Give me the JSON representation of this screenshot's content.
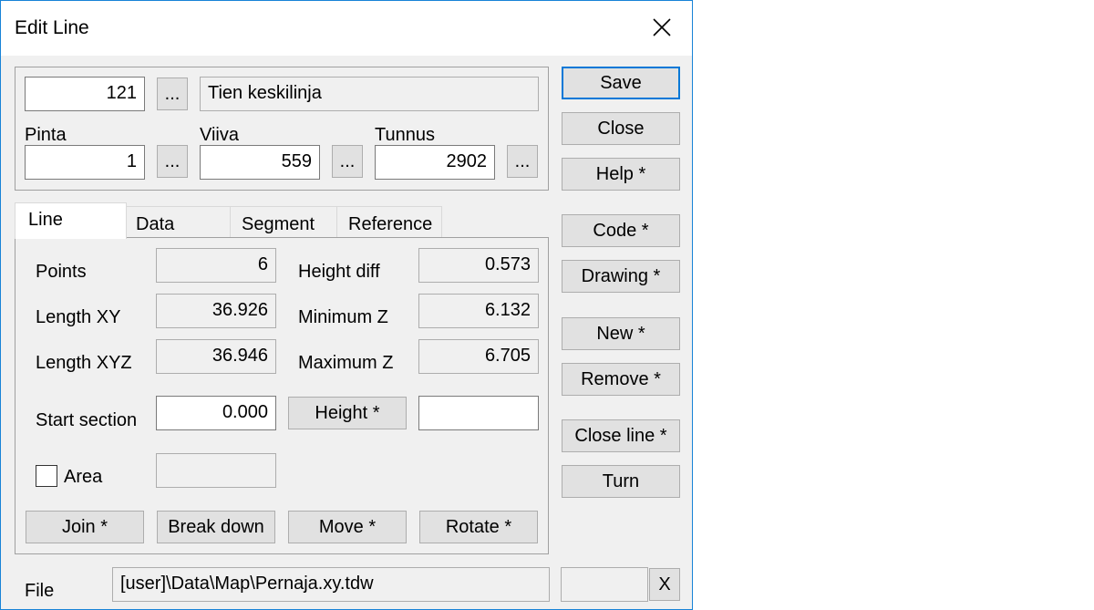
{
  "window": {
    "title": "Edit Line"
  },
  "header": {
    "code_value": "121",
    "code_name": "Tien keskilinja",
    "browse_label": "...",
    "pinta_label": "Pinta",
    "pinta_value": "1",
    "viiva_label": "Viiva",
    "viiva_value": "559",
    "tunnus_label": "Tunnus",
    "tunnus_value": "2902"
  },
  "tabs": [
    "Line",
    "Data",
    "Segment",
    "Reference"
  ],
  "line_tab": {
    "points_label": "Points",
    "points_value": "6",
    "length_xy_label": "Length XY",
    "length_xy_value": "36.926",
    "length_xyz_label": "Length XYZ",
    "length_xyz_value": "36.946",
    "height_diff_label": "Height diff",
    "height_diff_value": "0.573",
    "min_z_label": "Minimum Z",
    "min_z_value": "6.132",
    "max_z_label": "Maximum Z",
    "max_z_value": "6.705",
    "start_section_label": "Start section",
    "start_section_value": "0.000",
    "height_button": "Height *",
    "height_value": "",
    "area_label": "Area",
    "area_checked": false,
    "area_value": "",
    "join_button": "Join *",
    "break_down_button": "Break down",
    "move_button": "Move *",
    "rotate_button": "Rotate *"
  },
  "side_buttons": {
    "save": "Save",
    "close": "Close",
    "help": "Help *",
    "code": "Code *",
    "drawing": "Drawing *",
    "new": "New *",
    "remove": "Remove *",
    "close_line": "Close line *",
    "turn": "Turn"
  },
  "footer": {
    "file_label": "File",
    "file_path": "[user]\\Data\\Map\\Pernaja.xy.tdw",
    "extra_value": "",
    "clear_button": "X"
  },
  "colors": {
    "accent": "#0078d7",
    "window_border": "#1883d7",
    "button_bg": "#e1e1e1",
    "dialog_bg": "#f0f0f0"
  }
}
